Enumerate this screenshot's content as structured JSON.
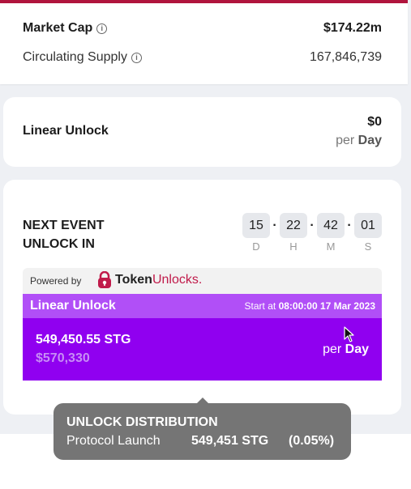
{
  "market": {
    "market_cap_label": "Market Cap",
    "market_cap_value": "$174.22m",
    "supply_label": "Circulating Supply",
    "supply_value": "167,846,739",
    "info_icon": "info-icon"
  },
  "linear_unlock_card": {
    "title": "Linear Unlock",
    "amount": "$0",
    "per": "per",
    "day": "Day"
  },
  "next_event": {
    "title_line1": "NEXT EVENT",
    "title_line2": "UNLOCK IN",
    "countdown": [
      {
        "value": "15",
        "unit": "D"
      },
      {
        "value": "22",
        "unit": "H"
      },
      {
        "value": "42",
        "unit": "M"
      },
      {
        "value": "01",
        "unit": "S"
      }
    ],
    "separator": "·"
  },
  "powered": {
    "text": "Powered by",
    "brand_token": "Token",
    "brand_unlocks": "Unlocks."
  },
  "unlock_event": {
    "title": "Linear Unlock",
    "start_prefix": "Start at",
    "start_time": "08:00:00 17 Mar 2023",
    "amount": "549,450.55 STG",
    "usd": "$570,330",
    "per": "per",
    "day": "Day"
  },
  "tooltip": {
    "title": "UNLOCK DISTRIBUTION",
    "category": "Protocol Launch",
    "amount": "549,451 STG",
    "percent": "(0.05%)"
  },
  "colors": {
    "accent_red": "#b0153d",
    "purple_header": "#b14ff7",
    "purple_body": "#9000f0",
    "tooltip_bg": "#757575"
  }
}
